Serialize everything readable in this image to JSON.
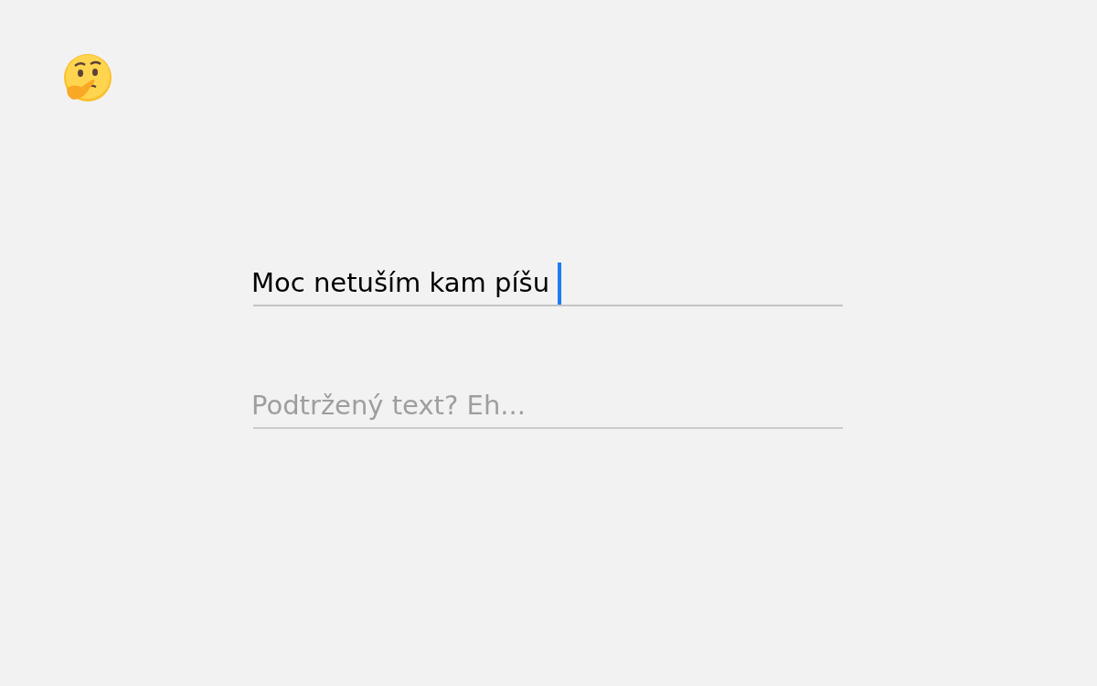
{
  "fields": [
    {
      "value": "Moc netuším kam píšu",
      "focused": true
    },
    {
      "placeholder": "Podtržený text? Eh...",
      "focused": false
    }
  ]
}
